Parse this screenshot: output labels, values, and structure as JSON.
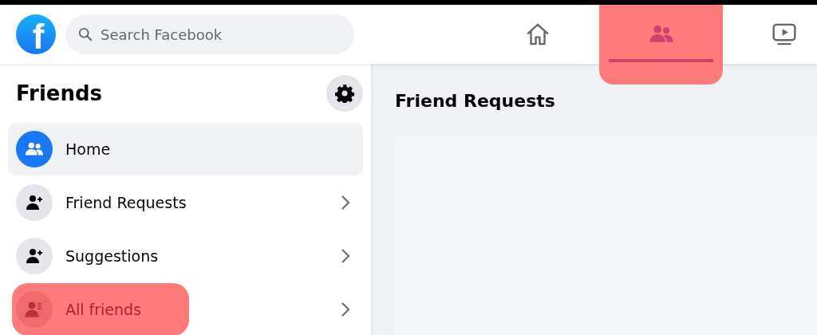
{
  "header": {
    "logo": {
      "letter": "f"
    },
    "search": {
      "placeholder": "Search Facebook"
    },
    "nav_tabs": [
      {
        "kind": "home",
        "selected": false,
        "highlighted": false
      },
      {
        "kind": "friends",
        "selected": true,
        "highlighted": true
      },
      {
        "kind": "watch",
        "selected": false,
        "highlighted": false
      }
    ]
  },
  "sidebar": {
    "title": "Friends",
    "items": [
      {
        "kind": "home",
        "label": "Home",
        "selected": true,
        "chevron": false,
        "highlighted": false
      },
      {
        "kind": "requests",
        "label": "Friend Requests",
        "selected": false,
        "chevron": true,
        "highlighted": false
      },
      {
        "kind": "suggestions",
        "label": "Suggestions",
        "selected": false,
        "chevron": true,
        "highlighted": false
      },
      {
        "kind": "all",
        "label": "All friends",
        "selected": false,
        "chevron": true,
        "highlighted": true
      }
    ]
  },
  "content": {
    "heading": "Friend Requests"
  }
}
